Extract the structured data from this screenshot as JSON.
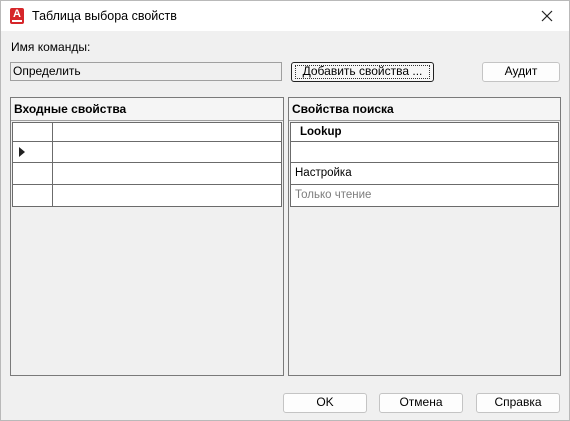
{
  "window": {
    "title": "Таблица выбора свойств",
    "app_icon_letter": "A"
  },
  "command": {
    "label": "Имя команды:",
    "value": "Определить"
  },
  "buttons": {
    "add_properties": "Добавить свойства ...",
    "audit": "Аудит",
    "ok": "OK",
    "cancel": "Отмена",
    "help": "Справка"
  },
  "input_properties": {
    "header": "Входные свойства",
    "rows": [
      "",
      "",
      "",
      ""
    ],
    "current_row_index": 1
  },
  "lookup_properties": {
    "header": "Свойства поиска",
    "rows": [
      "Lookup",
      "",
      "Настройка",
      "Только чтение"
    ]
  },
  "colors": {
    "app_icon": "#d6262a",
    "read_only_text": "#7d7d7d"
  }
}
